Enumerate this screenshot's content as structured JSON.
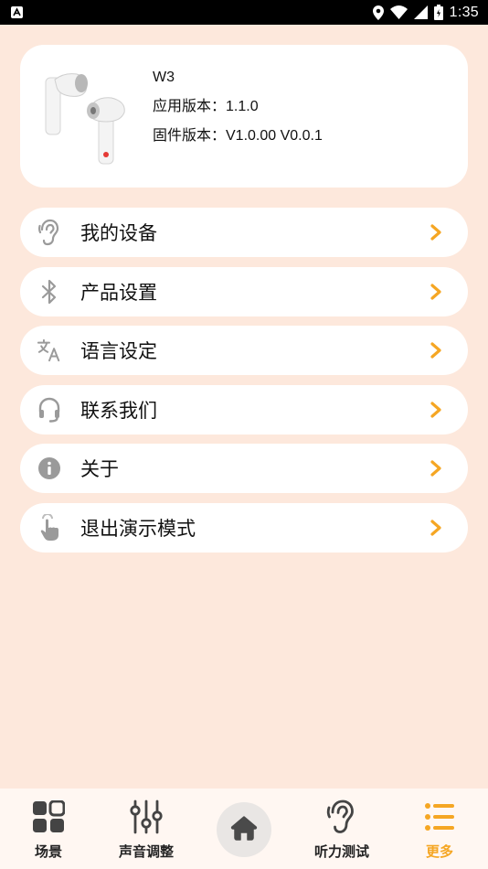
{
  "status_bar": {
    "time": "1:35",
    "icons": [
      "notification-icon",
      "location-icon",
      "wifi-icon",
      "signal-icon",
      "battery-icon"
    ]
  },
  "device": {
    "name": "W3",
    "app_version": "应用版本：1.1.0",
    "firmware_version": "固件版本：V1.0.00  V0.0.1",
    "image": "earbuds-image"
  },
  "menu": {
    "items": [
      {
        "label": "我的设备",
        "icon": "ear-icon"
      },
      {
        "label": "产品设置",
        "icon": "bluetooth-icon"
      },
      {
        "label": "语言设定",
        "icon": "translate-icon"
      },
      {
        "label": "联系我们",
        "icon": "headset-icon"
      },
      {
        "label": "关于",
        "icon": "info-icon"
      },
      {
        "label": "退出演示模式",
        "icon": "touch-icon"
      }
    ],
    "chevron_color": "#f5a623"
  },
  "bottom_nav": {
    "items": [
      {
        "label": "场景",
        "icon": "grid-icon"
      },
      {
        "label": "声音调整",
        "icon": "equalizer-icon"
      },
      {
        "label": "",
        "icon": "home-icon"
      },
      {
        "label": "听力测试",
        "icon": "hearing-icon"
      },
      {
        "label": "更多",
        "icon": "list-icon",
        "active": true
      }
    ],
    "active_color": "#f5a623"
  },
  "colors": {
    "background": "#fde8dc",
    "card": "#ffffff",
    "accent": "#f5a623"
  }
}
